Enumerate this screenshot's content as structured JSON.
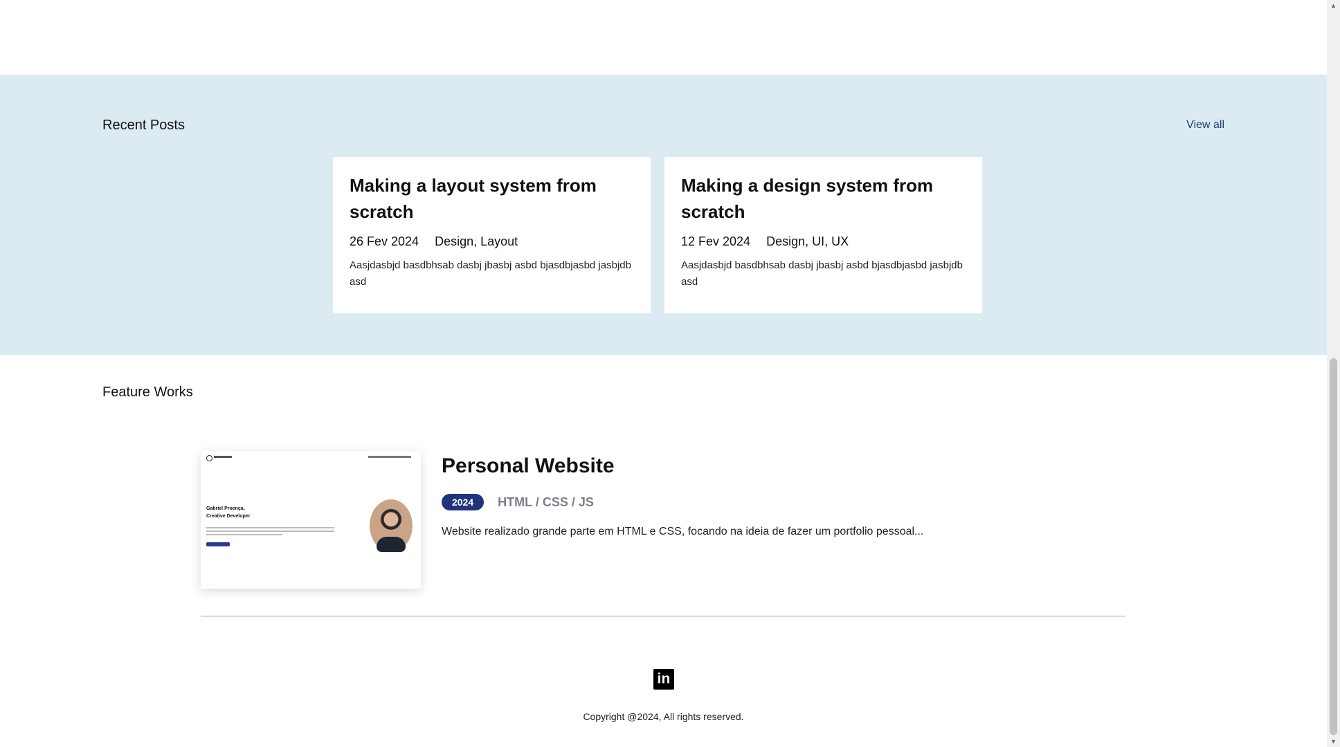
{
  "recent_posts": {
    "title": "Recent Posts",
    "view_all": "View all",
    "posts": [
      {
        "title": "Making a layout system from scratch",
        "date": "26 Fev 2024",
        "tags": "Design, Layout",
        "excerpt": "Aasjdasbjd basdbhsab dasbj jbasbj asbd bjasdbjasbd jasbjdb asd"
      },
      {
        "title": "Making a design system from scratch",
        "date": "12 Fev 2024",
        "tags": "Design, UI, UX",
        "excerpt": "Aasjdasbjd basdbhsab dasbj jbasbj asbd bjasdbjasbd jasbjdb asd"
      }
    ],
    "background": "#dbebf1"
  },
  "feature_works": {
    "title": "Feature Works",
    "works": [
      {
        "title": "Personal Website",
        "year": "2024",
        "tags": "HTML / CSS / JS",
        "description": "Website realizado grande parte em HTML e CSS, focando na ideia de fazer um portfolio pessoal...",
        "thumbnail": {
          "heading_line1": "Gabriel Proença,",
          "heading_line2": "Creative Developer"
        }
      }
    ],
    "badge_color": "#21337e"
  },
  "footer": {
    "social_icon": "linkedin-icon",
    "copyright": "Copyright @2024, All rights reserved."
  }
}
